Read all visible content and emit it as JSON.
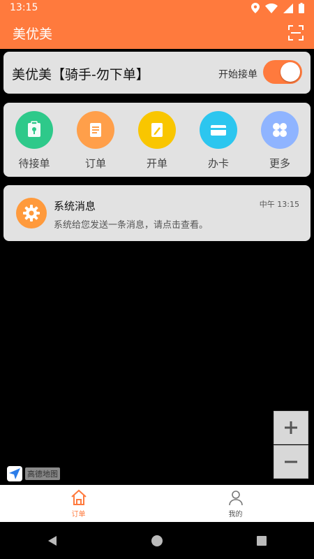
{
  "status_bar": {
    "time": "13:15"
  },
  "app_bar": {
    "title": "美优美"
  },
  "shop_card": {
    "shop_name": "美优美【骑手-勿下单】",
    "toggle_label": "开始接单",
    "toggle_on": true
  },
  "menu": {
    "items": [
      {
        "label": "待接单",
        "icon": "clipboard-pin-icon",
        "color": "#2ec98a"
      },
      {
        "label": "订单",
        "icon": "order-list-icon",
        "color": "#ff9f4a"
      },
      {
        "label": "开单",
        "icon": "edit-note-icon",
        "color": "#f9c600"
      },
      {
        "label": "办卡",
        "icon": "card-icon",
        "color": "#2cc6ef"
      },
      {
        "label": "更多",
        "icon": "grid-more-icon",
        "color": "#8fb4ff"
      }
    ]
  },
  "message": {
    "title": "系统消息",
    "time": "中午 13:15",
    "body": "系统给您发送一条消息，请点击查看。"
  },
  "map": {
    "logo_text": "高德地图"
  },
  "tab_bar": {
    "tabs": [
      {
        "label": "订单",
        "active": true
      },
      {
        "label": "我的",
        "active": false
      }
    ]
  },
  "colors": {
    "accent": "#ff7a3d"
  }
}
